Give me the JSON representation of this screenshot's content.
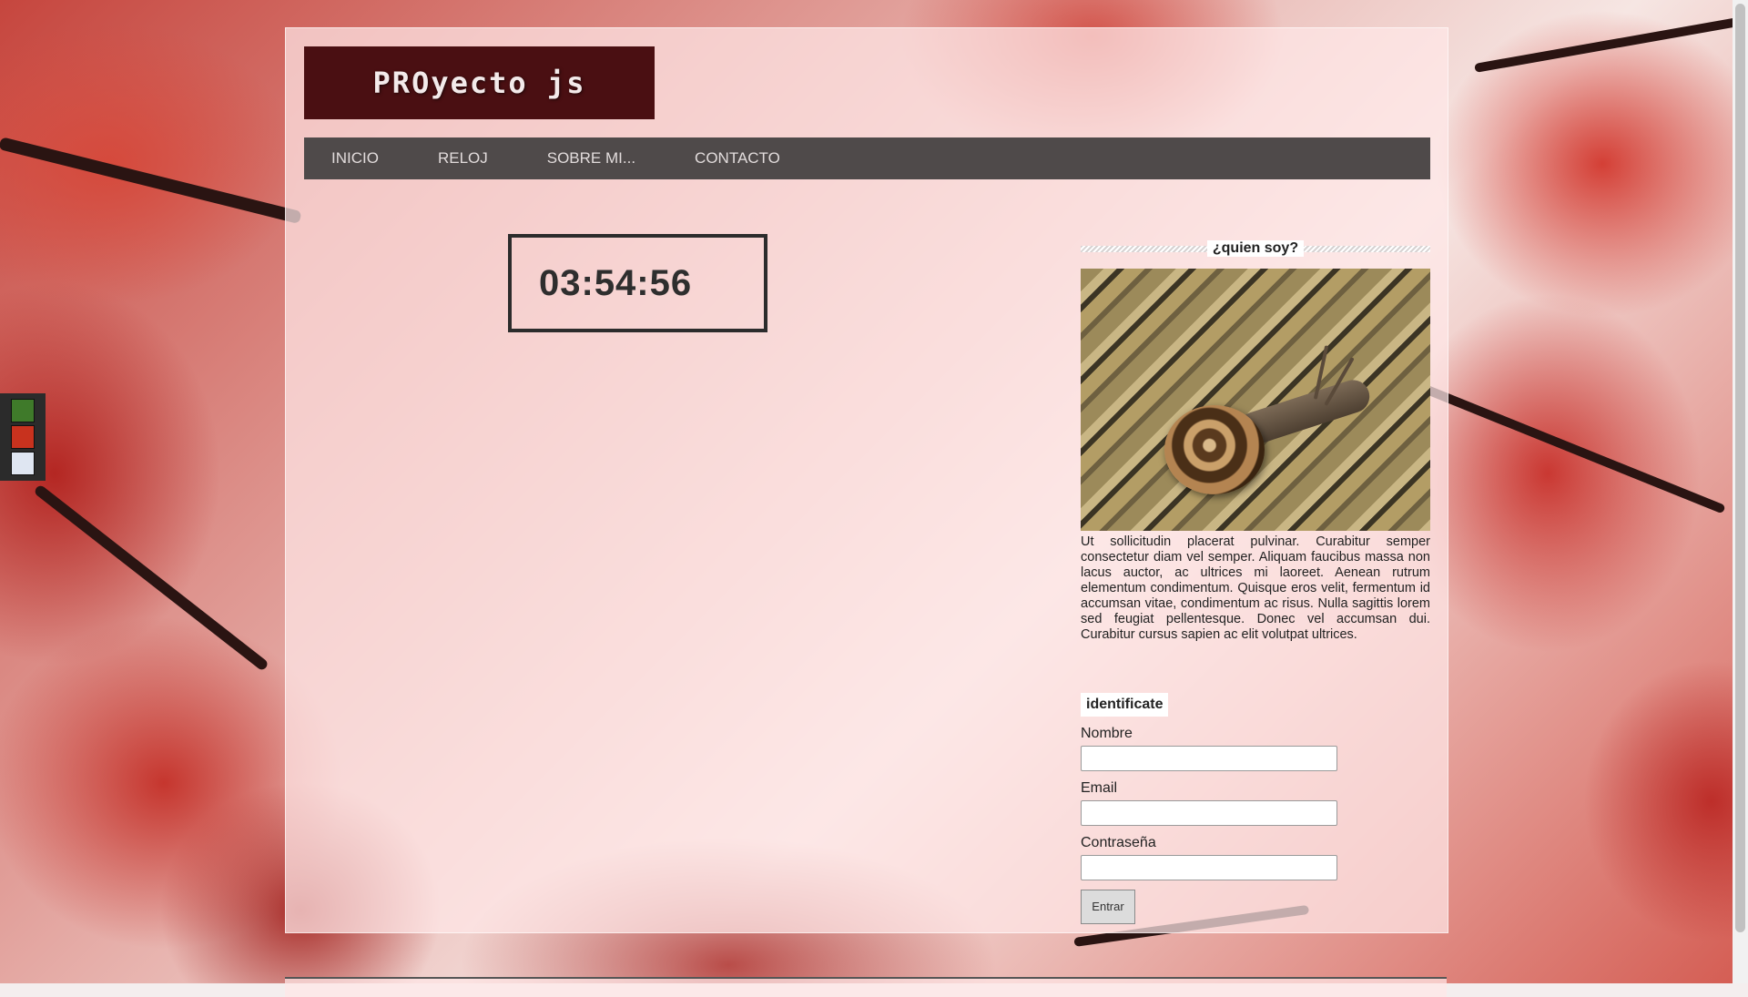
{
  "brand": {
    "title": "PROyecto js"
  },
  "nav": {
    "items": [
      {
        "label": "INICIO"
      },
      {
        "label": "RELOJ"
      },
      {
        "label": "SOBRE MI..."
      },
      {
        "label": "CONTACTO"
      }
    ]
  },
  "clock": {
    "time": "03:54:56"
  },
  "sidebar": {
    "about_heading": "¿quien soy?",
    "about_text": "Ut sollicitudin placerat pulvinar. Curabitur semper consectetur diam vel semper. Aliquam faucibus massa non lacus auctor, ac ultrices mi laoreet. Aenean rutrum elementum condimentum. Quisque eros velit, fermentum id accumsan vitae, condimentum ac risus. Nulla sagittis lorem sed feugiat pellentesque. Donec vel accumsan dui. Curabitur cursus sapien ac elit volutpat ultrices.",
    "form": {
      "title": "identificate",
      "name_label": "Nombre",
      "email_label": "Email",
      "password_label": "Contraseña",
      "submit_label": "Entrar"
    }
  },
  "theme_swatches": [
    {
      "name": "green",
      "color": "#3f7a2a"
    },
    {
      "name": "red",
      "color": "#c8321e"
    },
    {
      "name": "light-blue",
      "color": "#dfe6f2"
    }
  ],
  "colors": {
    "logo_bg": "#4a0f12",
    "nav_bg": "#4f4a4a"
  }
}
